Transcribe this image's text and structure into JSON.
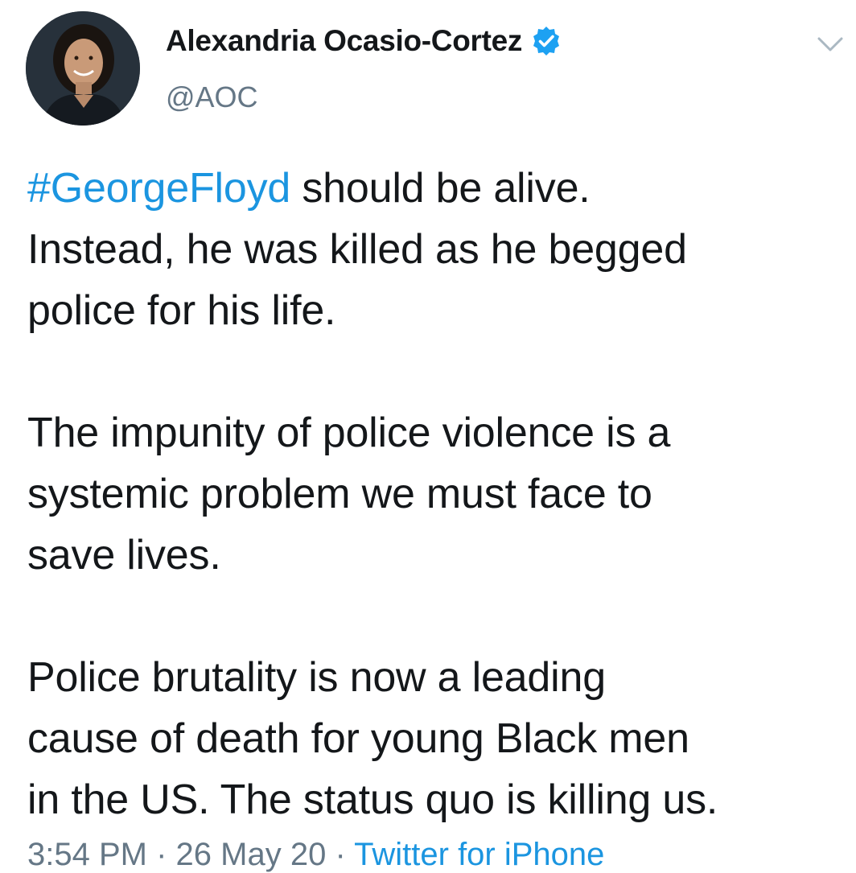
{
  "author": {
    "display_name": "Alexandria Ocasio-Cortez",
    "handle": "@AOC",
    "verified": true
  },
  "tweet": {
    "hashtag": "#GeorgeFloyd",
    "line1_rest": " should be alive.",
    "line2": "Instead, he was killed as he begged",
    "line3": "police for his life.",
    "line4": "The impunity of police violence is a",
    "line5": "systemic problem we must face to",
    "line6": "save lives.",
    "line7": "Police brutality is now a leading",
    "line8": "cause of death for young Black men",
    "line9": "in the US. The status quo is killing us."
  },
  "meta": {
    "time": "3:54 PM",
    "date": "26 May 20",
    "source": "Twitter for iPhone"
  },
  "colors": {
    "link": "#1b95e0",
    "text": "#14171a",
    "secondary": "#657786",
    "verified_badge": "#1da1f2"
  },
  "icons": {
    "verified": "verified-badge-icon",
    "menu": "chevron-down-icon"
  }
}
